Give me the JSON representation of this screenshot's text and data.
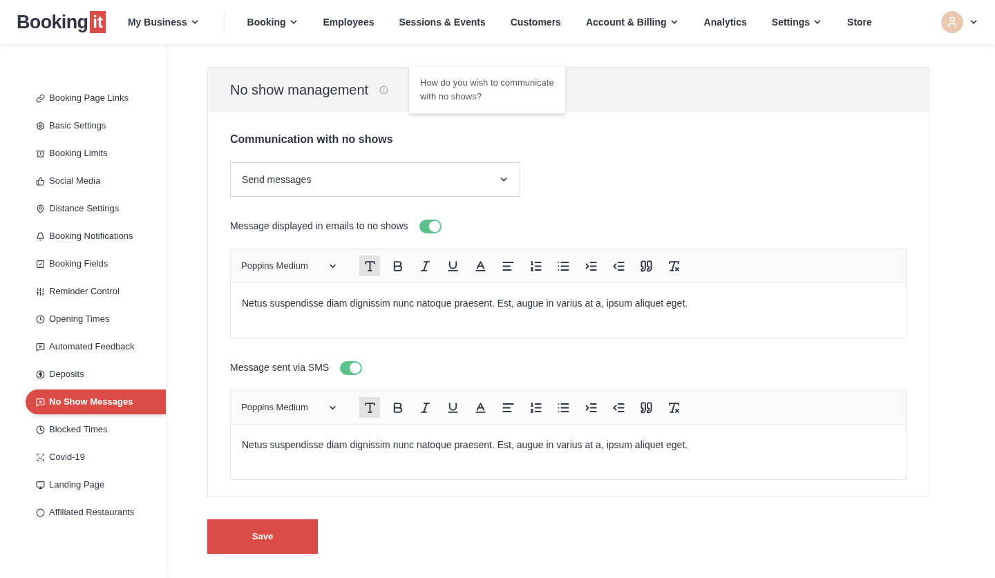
{
  "logo": {
    "word": "Booking",
    "badge": "it"
  },
  "nav": [
    {
      "label": "My Business",
      "dropdown": true
    },
    {
      "label": "Booking",
      "dropdown": true
    },
    {
      "label": "Employees",
      "dropdown": false
    },
    {
      "label": "Sessions & Events",
      "dropdown": false
    },
    {
      "label": "Customers",
      "dropdown": false
    },
    {
      "label": "Account & Billing",
      "dropdown": true
    },
    {
      "label": "Analytics",
      "dropdown": false
    },
    {
      "label": "Settings",
      "dropdown": true
    },
    {
      "label": "Store",
      "dropdown": false
    }
  ],
  "sidebar": {
    "items": [
      {
        "label": "Booking Page Links",
        "kind": "link",
        "selected": false
      },
      {
        "label": "Basic Settings",
        "kind": "gear",
        "selected": false
      },
      {
        "label": "Booking Limits",
        "kind": "alarm",
        "selected": false
      },
      {
        "label": "Social Media",
        "kind": "thumb",
        "selected": false
      },
      {
        "label": "Distance Settings",
        "kind": "pin",
        "selected": false
      },
      {
        "label": "Booking Notifications",
        "kind": "bell",
        "selected": false
      },
      {
        "label": "Booking Fields",
        "kind": "copy",
        "selected": false
      },
      {
        "label": "Reminder Control",
        "kind": "sliders",
        "selected": false
      },
      {
        "label": "Opening Times",
        "kind": "clock",
        "selected": false
      },
      {
        "label": "Automated Feedback",
        "kind": "message",
        "selected": false
      },
      {
        "label": "Deposits",
        "kind": "coin",
        "selected": false
      },
      {
        "label": "No Show Messages",
        "kind": "message",
        "selected": true
      },
      {
        "label": "Blocked Times",
        "kind": "clock",
        "selected": false
      },
      {
        "label": "Covid-19",
        "kind": "virus",
        "selected": false
      },
      {
        "label": "Landing Page",
        "kind": "monitor",
        "selected": false
      },
      {
        "label": "Affiliated Restaurants",
        "kind": "circle",
        "selected": false
      }
    ]
  },
  "panel": {
    "title": "No show management",
    "tooltip": "How do you wish to communicate with no shows?",
    "section_title": "Communication with no shows",
    "select": {
      "value": "Send messages"
    },
    "editors": [
      {
        "label": "Message displayed in emails to no shows",
        "on": true,
        "font": "Poppins Medium",
        "text": "Netus suspendisse diam dignissim nunc natoque praesent. Est, augue in varius at a, ipsum aliquet eget.",
        "tools": [
          {
            "kind": "size",
            "selected": true
          },
          {
            "kind": "bold",
            "selected": false
          },
          {
            "kind": "italic",
            "selected": false
          },
          {
            "kind": "underline",
            "selected": false
          },
          {
            "kind": "color",
            "selected": false
          },
          {
            "kind": "align",
            "selected": false
          },
          {
            "kind": "ordered",
            "selected": false
          },
          {
            "kind": "bullets",
            "selected": false
          },
          {
            "kind": "indent",
            "selected": false
          },
          {
            "kind": "outdent",
            "selected": false
          },
          {
            "kind": "quote",
            "selected": false
          },
          {
            "kind": "clear",
            "selected": false
          }
        ]
      },
      {
        "label": "Message sent via SMS",
        "on": true,
        "font": "Poppins Medium",
        "text": "Netus suspendisse diam dignissim nunc natoque praesent. Est, augue in varius at a, ipsum aliquet eget.",
        "tools": [
          {
            "kind": "size",
            "selected": true
          },
          {
            "kind": "bold",
            "selected": false
          },
          {
            "kind": "italic",
            "selected": false
          },
          {
            "kind": "underline",
            "selected": false
          },
          {
            "kind": "color",
            "selected": false
          },
          {
            "kind": "align",
            "selected": false
          },
          {
            "kind": "ordered",
            "selected": false
          },
          {
            "kind": "bullets",
            "selected": false
          },
          {
            "kind": "indent",
            "selected": false
          },
          {
            "kind": "outdent",
            "selected": false
          },
          {
            "kind": "quote",
            "selected": false
          },
          {
            "kind": "clear",
            "selected": false
          }
        ]
      }
    ]
  },
  "save_button": "Save"
}
